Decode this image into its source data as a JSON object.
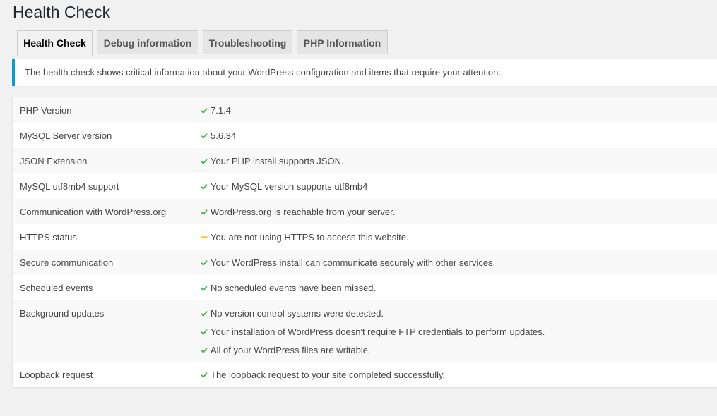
{
  "page": {
    "title": "Health Check"
  },
  "tabs": [
    {
      "label": "Health Check",
      "active": true
    },
    {
      "label": "Debug information",
      "active": false
    },
    {
      "label": "Troubleshooting",
      "active": false
    },
    {
      "label": "PHP Information",
      "active": false
    }
  ],
  "notice": {
    "text": "The health check shows critical information about your WordPress configuration and items that require your attention.",
    "accent_color": "#00a0d2"
  },
  "status_colors": {
    "good": "#46b450",
    "warning": "#ffb900"
  },
  "checks": [
    {
      "label": "PHP Version",
      "results": [
        {
          "status": "good",
          "icon": "checkmark-icon",
          "text": "7.1.4"
        }
      ]
    },
    {
      "label": "MySQL Server version",
      "results": [
        {
          "status": "good",
          "icon": "checkmark-icon",
          "text": "5.6.34"
        }
      ]
    },
    {
      "label": "JSON Extension",
      "results": [
        {
          "status": "good",
          "icon": "checkmark-icon",
          "text": "Your PHP install supports JSON."
        }
      ]
    },
    {
      "label": "MySQL utf8mb4 support",
      "results": [
        {
          "status": "good",
          "icon": "checkmark-icon",
          "text": "Your MySQL version supports utf8mb4"
        }
      ]
    },
    {
      "label": "Communication with WordPress.org",
      "results": [
        {
          "status": "good",
          "icon": "checkmark-icon",
          "text": "WordPress.org is reachable from your server."
        }
      ]
    },
    {
      "label": "HTTPS status",
      "results": [
        {
          "status": "warning",
          "icon": "warning-dash-icon",
          "text": "You are not using HTTPS to access this website."
        }
      ]
    },
    {
      "label": "Secure communication",
      "results": [
        {
          "status": "good",
          "icon": "checkmark-icon",
          "text": "Your WordPress install can communicate securely with other services."
        }
      ]
    },
    {
      "label": "Scheduled events",
      "results": [
        {
          "status": "good",
          "icon": "checkmark-icon",
          "text": "No scheduled events have been missed."
        }
      ]
    },
    {
      "label": "Background updates",
      "results": [
        {
          "status": "good",
          "icon": "checkmark-icon",
          "text": "No version control systems were detected."
        },
        {
          "status": "good",
          "icon": "checkmark-icon",
          "text": "Your installation of WordPress doesn't require FTP credentials to perform updates."
        },
        {
          "status": "good",
          "icon": "checkmark-icon",
          "text": "All of your WordPress files are writable."
        }
      ]
    },
    {
      "label": "Loopback request",
      "results": [
        {
          "status": "good",
          "icon": "checkmark-icon",
          "text": "The loopback request to your site completed successfully."
        }
      ]
    }
  ]
}
